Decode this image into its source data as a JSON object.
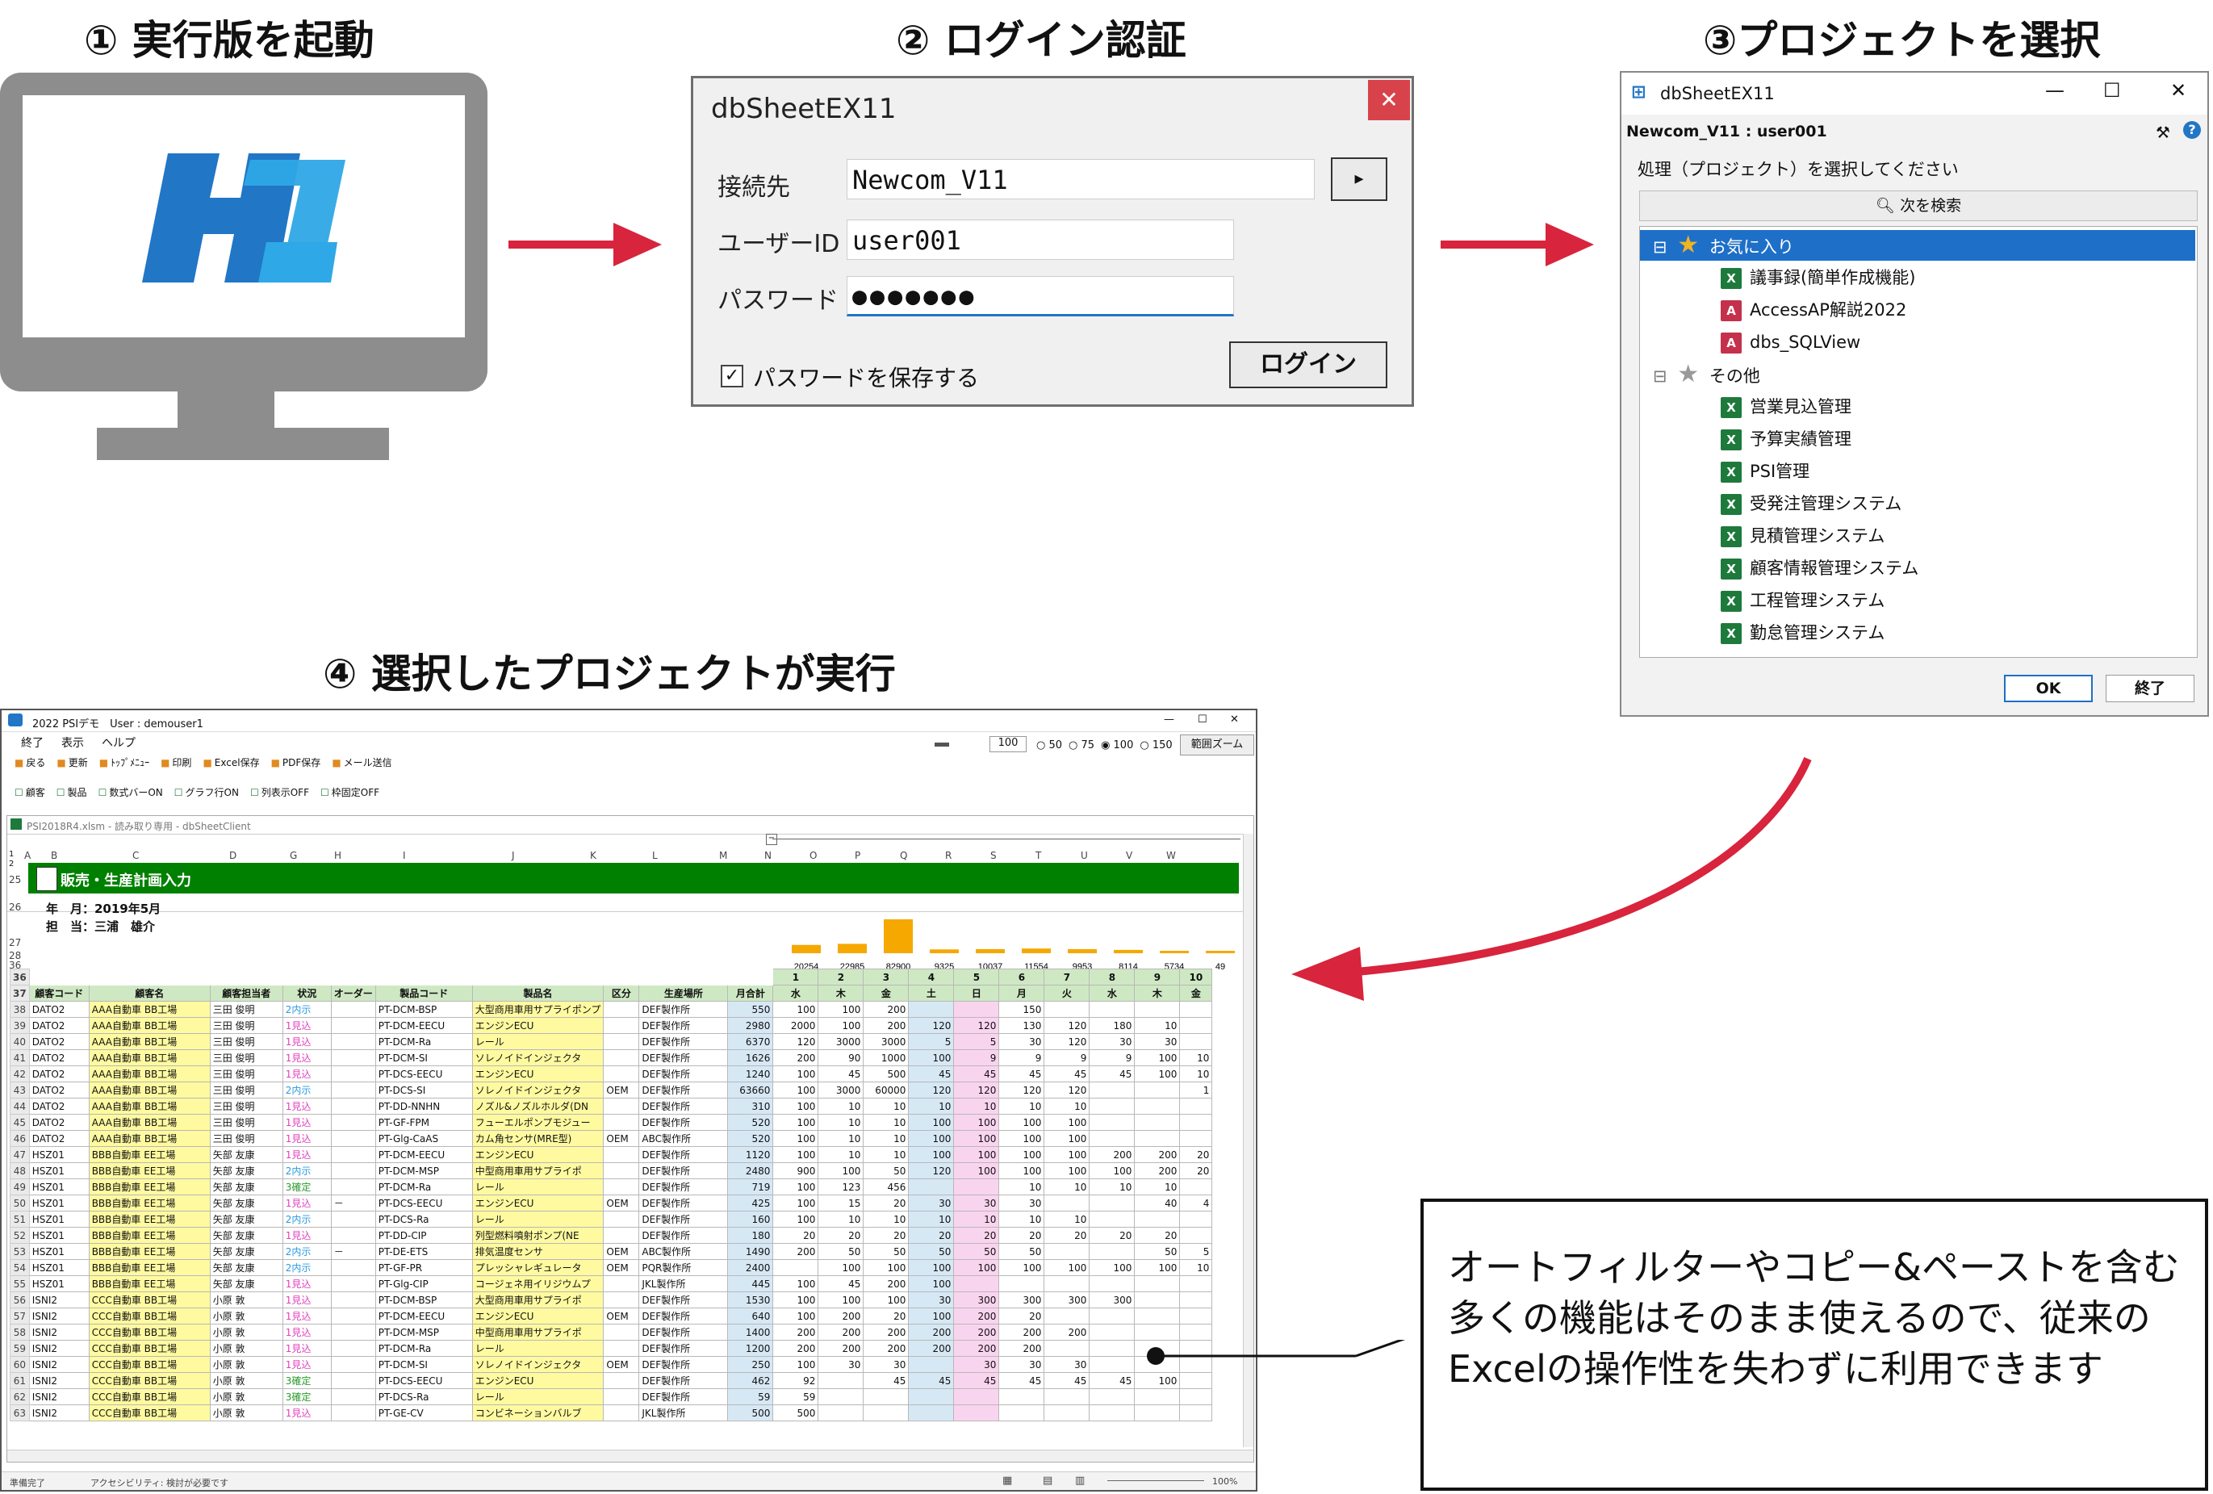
{
  "steps": {
    "s1": "① 実行版を起動",
    "s2": "② ログイン認証",
    "s3": "③プロジェクトを選択",
    "s4": "④ 選択したプロジェクトが実行"
  },
  "colors": {
    "accent": "#d8243c",
    "excel_green": "#008000",
    "logo_dark": "#2176c6",
    "logo_light": "#2ea8e6"
  },
  "login": {
    "title": "dbSheetEX11",
    "close_icon": "close-icon",
    "connection_label": "接続先",
    "connection_value": "Newcom_V11",
    "user_label": "ユーザーID",
    "user_value": "user001",
    "password_label": "パスワード",
    "password_value": "●●●●●●●",
    "save_password_label": "パスワードを保存する",
    "save_password_checked": true,
    "login_button": "ログイン"
  },
  "project": {
    "title": "dbSheetEX11",
    "connection": "Newcom_V11 : user001",
    "prompt": "処理（プロジェクト）を選択してください",
    "search_button": "次を検索",
    "favorites_label": "お気に入り",
    "favorites": [
      {
        "label": "議事録(簡単作成機能)",
        "icon": "X"
      },
      {
        "label": "AccessAP解説2022",
        "icon": "A"
      },
      {
        "label": "dbs_SQLView",
        "icon": "A"
      }
    ],
    "others_label": "その他",
    "others": [
      {
        "label": "営業見込管理",
        "icon": "X"
      },
      {
        "label": "予算実績管理",
        "icon": "X"
      },
      {
        "label": "PSI管理",
        "icon": "X"
      },
      {
        "label": "受発注管理システム",
        "icon": "X"
      },
      {
        "label": "見積管理システム",
        "icon": "X"
      },
      {
        "label": "顧客情報管理システム",
        "icon": "X"
      },
      {
        "label": "工程管理システム",
        "icon": "X"
      },
      {
        "label": "勤怠管理システム",
        "icon": "X"
      }
    ],
    "ok_button": "OK",
    "exit_button": "終了"
  },
  "excel": {
    "title": "2022 PSIデモ　User : demouser1",
    "menu": [
      "終了",
      "表示",
      "ヘルプ"
    ],
    "toolbar1": [
      "戻る",
      "更新",
      "ﾄｯﾌﾟﾒﾆｭｰ",
      "印刷",
      "Excel保存",
      "PDF保存",
      "メール送信"
    ],
    "toolbar2": [
      "顧客",
      "製品",
      "数式バーON",
      "グラフ行ON",
      "列表示OFF",
      "枠固定OFF"
    ],
    "zoom_value": "100",
    "zoom_options": [
      "50",
      "75",
      "100",
      "150"
    ],
    "zoom_button": "範囲ズーム",
    "workbook_title": "PSI2018R4.xlsm - 読み取り専用 - dbSheetClient",
    "sheet_title": "販売・生産計画入力",
    "year_month": "年　月：2019年5月",
    "person": "担　当：三浦　雄介",
    "col_letters": [
      "A",
      "B",
      "C",
      "D",
      "G",
      "H",
      "I",
      "J",
      "K",
      "L",
      "M",
      "N",
      "O",
      "P",
      "Q",
      "R",
      "S",
      "T",
      "U",
      "V",
      "W"
    ],
    "row_numbers_top": [
      "25",
      "26",
      "27",
      "28",
      "36"
    ],
    "chart_totals": [
      "20254",
      "22985",
      "82900",
      "9325",
      "10037",
      "11554",
      "9953",
      "8114",
      "5734",
      "49"
    ],
    "day_numbers": [
      "1",
      "2",
      "3",
      "4",
      "5",
      "6",
      "7",
      "8",
      "9",
      "10"
    ],
    "weekdays": [
      "水",
      "木",
      "金",
      "土",
      "日",
      "月",
      "火",
      "水",
      "木",
      "金"
    ],
    "headers": [
      "顧客コード",
      "顧客名",
      "顧客担当者",
      "状況",
      "オーダー",
      "製品コード",
      "製品名",
      "区分",
      "生産場所",
      "月合計"
    ],
    "rows": [
      [
        "38",
        "DATO2",
        "AAA自動車 BB工場",
        "三田 俊明",
        "2内示",
        "",
        "PT-DCM-BSP",
        "大型商用車用サプライポンプ",
        "",
        "DEF製作所",
        "550",
        "100",
        "100",
        "200",
        "",
        "",
        "150",
        "",
        "",
        "",
        ""
      ],
      [
        "39",
        "DATO2",
        "AAA自動車 BB工場",
        "三田 俊明",
        "1見込",
        "",
        "PT-DCM-EECU",
        "エンジンECU",
        "",
        "DEF製作所",
        "2980",
        "2000",
        "100",
        "200",
        "120",
        "120",
        "130",
        "120",
        "180",
        "10",
        ""
      ],
      [
        "40",
        "DATO2",
        "AAA自動車 BB工場",
        "三田 俊明",
        "1見込",
        "",
        "PT-DCM-Ra",
        "レール",
        "",
        "DEF製作所",
        "6370",
        "120",
        "3000",
        "3000",
        "5",
        "5",
        "30",
        "120",
        "30",
        "30",
        ""
      ],
      [
        "41",
        "DATO2",
        "AAA自動車 BB工場",
        "三田 俊明",
        "1見込",
        "",
        "PT-DCM-SI",
        "ソレノイドインジェクタ",
        "",
        "DEF製作所",
        "1626",
        "200",
        "90",
        "1000",
        "100",
        "9",
        "9",
        "9",
        "9",
        "100",
        "10"
      ],
      [
        "42",
        "DATO2",
        "AAA自動車 BB工場",
        "三田 俊明",
        "1見込",
        "",
        "PT-DCS-EECU",
        "エンジンECU",
        "",
        "DEF製作所",
        "1240",
        "100",
        "45",
        "500",
        "45",
        "45",
        "45",
        "45",
        "45",
        "100",
        "10"
      ],
      [
        "43",
        "DATO2",
        "AAA自動車 BB工場",
        "三田 俊明",
        "2内示",
        "",
        "PT-DCS-SI",
        "ソレノイドインジェクタ",
        "OEM",
        "DEF製作所",
        "63660",
        "100",
        "3000",
        "60000",
        "120",
        "120",
        "120",
        "120",
        "",
        "",
        "1"
      ],
      [
        "44",
        "DATO2",
        "AAA自動車 BB工場",
        "三田 俊明",
        "1見込",
        "",
        "PT-DD-NNHN",
        "ノズル&ノズルホルダ(DN",
        "",
        "DEF製作所",
        "310",
        "100",
        "10",
        "10",
        "10",
        "10",
        "10",
        "10",
        "",
        "",
        ""
      ],
      [
        "45",
        "DATO2",
        "AAA自動車 BB工場",
        "三田 俊明",
        "1見込",
        "",
        "PT-GF-FPM",
        "フューエルポンプモジュー",
        "",
        "DEF製作所",
        "520",
        "100",
        "10",
        "10",
        "100",
        "100",
        "100",
        "100",
        "",
        "",
        ""
      ],
      [
        "46",
        "DATO2",
        "AAA自動車 BB工場",
        "三田 俊明",
        "1見込",
        "",
        "PT-Glg-CaAS",
        "カム角センサ(MRE型)",
        "OEM",
        "ABC製作所",
        "520",
        "100",
        "10",
        "10",
        "100",
        "100",
        "100",
        "100",
        "",
        "",
        ""
      ],
      [
        "47",
        "HSZ01",
        "BBB自動車 EE工場",
        "矢部 友康",
        "1見込",
        "",
        "PT-DCM-EECU",
        "エンジンECU",
        "",
        "DEF製作所",
        "1120",
        "100",
        "10",
        "10",
        "100",
        "100",
        "100",
        "100",
        "200",
        "200",
        "20"
      ],
      [
        "48",
        "HSZ01",
        "BBB自動車 EE工場",
        "矢部 友康",
        "2内示",
        "",
        "PT-DCM-MSP",
        "中型商用車用サプライポ",
        "",
        "DEF製作所",
        "2480",
        "900",
        "100",
        "50",
        "120",
        "100",
        "100",
        "100",
        "100",
        "200",
        "20"
      ],
      [
        "49",
        "HSZ01",
        "BBB自動車 EE工場",
        "矢部 友康",
        "3確定",
        "",
        "PT-DCM-Ra",
        "レール",
        "",
        "DEF製作所",
        "719",
        "100",
        "123",
        "456",
        "",
        "",
        "10",
        "10",
        "10",
        "10",
        ""
      ],
      [
        "50",
        "HSZ01",
        "BBB自動車 EE工場",
        "矢部 友康",
        "1見込",
        "－",
        "PT-DCS-EECU",
        "エンジンECU",
        "OEM",
        "DEF製作所",
        "425",
        "100",
        "15",
        "20",
        "30",
        "30",
        "30",
        "",
        "",
        "40",
        "4"
      ],
      [
        "51",
        "HSZ01",
        "BBB自動車 EE工場",
        "矢部 友康",
        "2内示",
        "",
        "PT-DCS-Ra",
        "レール",
        "",
        "DEF製作所",
        "160",
        "100",
        "10",
        "10",
        "10",
        "10",
        "10",
        "10",
        "",
        "",
        ""
      ],
      [
        "52",
        "HSZ01",
        "BBB自動車 EE工場",
        "矢部 友康",
        "1見込",
        "",
        "PT-DD-CIP",
        "列型燃料噴射ポンプ(NE",
        "",
        "DEF製作所",
        "180",
        "20",
        "20",
        "20",
        "20",
        "20",
        "20",
        "20",
        "20",
        "20",
        ""
      ],
      [
        "53",
        "HSZ01",
        "BBB自動車 EE工場",
        "矢部 友康",
        "2内示",
        "－",
        "PT-DE-ETS",
        "排気温度センサ",
        "OEM",
        "ABC製作所",
        "1490",
        "200",
        "50",
        "50",
        "50",
        "50",
        "50",
        "",
        "",
        "50",
        "5"
      ],
      [
        "54",
        "HSZ01",
        "BBB自動車 EE工場",
        "矢部 友康",
        "2内示",
        "",
        "PT-GF-PR",
        "プレッシャレギュレータ",
        "OEM",
        "PQR製作所",
        "2400",
        "",
        "100",
        "100",
        "100",
        "100",
        "100",
        "100",
        "100",
        "100",
        "10"
      ],
      [
        "55",
        "HSZ01",
        "BBB自動車 EE工場",
        "矢部 友康",
        "1見込",
        "",
        "PT-Glg-CIP",
        "コージェネ用イリジウムプ",
        "",
        "JKL製作所",
        "445",
        "100",
        "45",
        "200",
        "100",
        "",
        "",
        "",
        "",
        "",
        ""
      ],
      [
        "56",
        "ISNI2",
        "CCC自動車 BB工場",
        "小原 敦",
        "1見込",
        "",
        "PT-DCM-BSP",
        "大型商用車用サプライポ",
        "",
        "DEF製作所",
        "1530",
        "100",
        "100",
        "100",
        "30",
        "300",
        "300",
        "300",
        "300",
        "",
        ""
      ],
      [
        "57",
        "ISNI2",
        "CCC自動車 BB工場",
        "小原 敦",
        "1見込",
        "",
        "PT-DCM-EECU",
        "エンジンECU",
        "OEM",
        "DEF製作所",
        "640",
        "100",
        "200",
        "20",
        "100",
        "200",
        "20",
        "",
        "",
        "",
        ""
      ],
      [
        "58",
        "ISNI2",
        "CCC自動車 BB工場",
        "小原 敦",
        "1見込",
        "",
        "PT-DCM-MSP",
        "中型商用車用サプライポ",
        "",
        "DEF製作所",
        "1400",
        "200",
        "200",
        "200",
        "200",
        "200",
        "200",
        "200",
        "",
        "",
        ""
      ],
      [
        "59",
        "ISNI2",
        "CCC自動車 BB工場",
        "小原 敦",
        "1見込",
        "",
        "PT-DCM-Ra",
        "レール",
        "",
        "DEF製作所",
        "1200",
        "200",
        "200",
        "200",
        "200",
        "200",
        "200",
        "",
        "",
        "",
        ""
      ],
      [
        "60",
        "ISNI2",
        "CCC自動車 BB工場",
        "小原 敦",
        "1見込",
        "",
        "PT-DCM-SI",
        "ソレノイドインジェクタ",
        "OEM",
        "DEF製作所",
        "250",
        "100",
        "30",
        "30",
        "",
        "30",
        "30",
        "30",
        "",
        "",
        ""
      ],
      [
        "61",
        "ISNI2",
        "CCC自動車 BB工場",
        "小原 敦",
        "3確定",
        "",
        "PT-DCS-EECU",
        "エンジンECU",
        "",
        "DEF製作所",
        "462",
        "92",
        "",
        "45",
        "45",
        "45",
        "45",
        "45",
        "45",
        "100",
        ""
      ],
      [
        "62",
        "ISNI2",
        "CCC自動車 BB工場",
        "小原 敦",
        "3確定",
        "",
        "PT-DCS-Ra",
        "レール",
        "",
        "DEF製作所",
        "59",
        "59",
        "",
        "",
        "",
        "",
        "",
        "",
        "",
        "",
        ""
      ],
      [
        "63",
        "ISNI2",
        "CCC自動車 BB工場",
        "小原 敦",
        "1見込",
        "",
        "PT-GE-CV",
        "コンビネーションバルブ",
        "",
        "JKL製作所",
        "500",
        "500",
        "",
        "",
        "",
        "",
        "",
        "",
        "",
        "",
        ""
      ]
    ],
    "status_left": "準備完了",
    "accessibility": "アクセシビリティ: 検討が必要です",
    "zoom_pct": "100%"
  },
  "note": "オートフィルターやコピー&ペーストを含む多くの機能はそのまま使えるので、従来のExcelの操作性を失わずに利用できます"
}
